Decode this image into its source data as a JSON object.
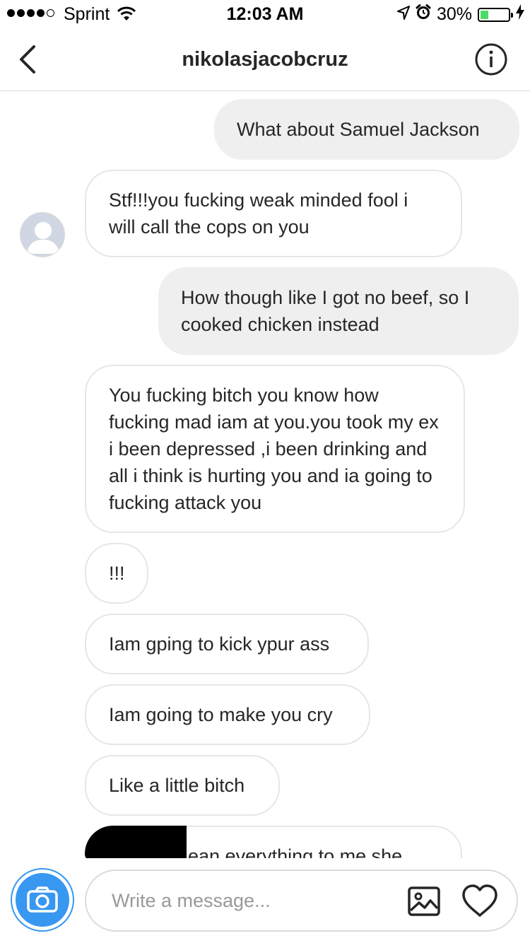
{
  "status_bar": {
    "carrier": "Sprint",
    "time": "12:03 AM",
    "battery_percent": "30%",
    "battery_level": 0.3,
    "signal_bars_filled": 4,
    "signal_bars_total": 5,
    "icons": [
      "wifi-icon",
      "location-arrow-icon",
      "alarm-clock-icon",
      "battery-icon",
      "charging-bolt-icon"
    ]
  },
  "header": {
    "title": "nikolasjacobcruz",
    "icons": [
      "back-chevron-icon",
      "info-icon"
    ]
  },
  "messages": [
    {
      "sender": "me",
      "text": "What about Samuel Jackson"
    },
    {
      "sender": "them",
      "text": "Stf!!!you fucking weak minded fool i will call the cops on you"
    },
    {
      "sender": "me",
      "text": "How though like I got no beef, so I cooked chicken instead"
    },
    {
      "sender": "them",
      "text": "You fucking bitch you know how fucking mad iam at you.you took my ex i been depressed ,i been drinking and all i think is hurting you and ia going to fucking attack you"
    },
    {
      "sender": "them",
      "text": "!!!"
    },
    {
      "sender": "them",
      "text": "Iam gping to kick ypur ass"
    },
    {
      "sender": "them",
      "text": "Iam going to make you cry"
    },
    {
      "sender": "them",
      "text": "Like a little bitch"
    },
    {
      "sender": "them",
      "text": "ean everything to me she",
      "partially_visible": true,
      "partially_redacted": true
    }
  ],
  "composer": {
    "placeholder": "Write a message...",
    "value": "",
    "icons": [
      "camera-icon",
      "gallery-icon",
      "heart-icon"
    ]
  },
  "colors": {
    "accent_blue": "#3897f0",
    "outgoing_bubble": "#efefef",
    "incoming_border": "#e6e6e6",
    "battery_green": "#4cd964",
    "text": "#262626",
    "placeholder": "#999999"
  }
}
